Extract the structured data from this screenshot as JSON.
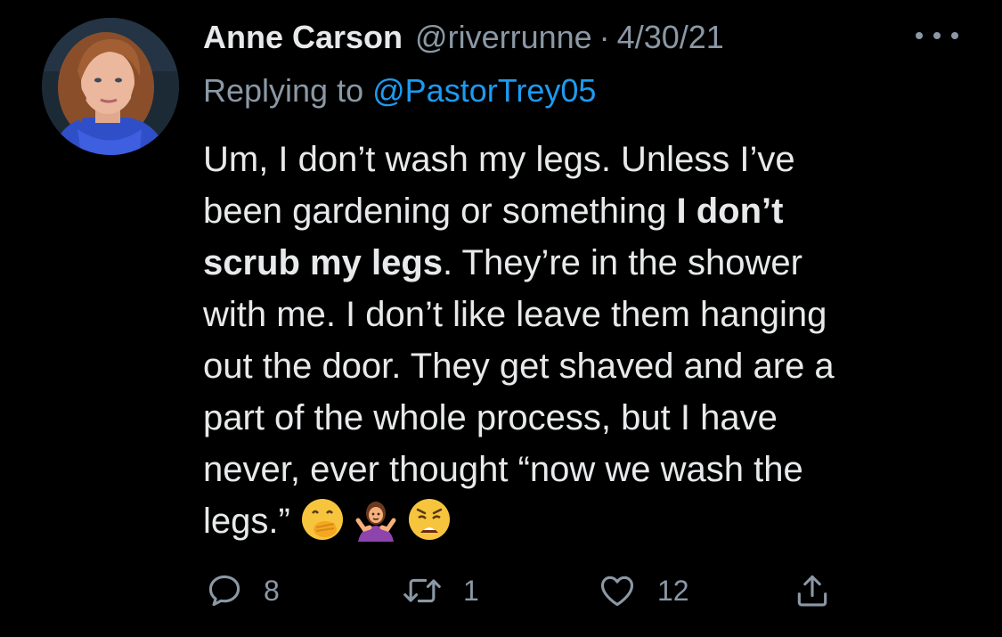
{
  "tweet": {
    "author_name": "Anne Carson",
    "handle": "@riverrunne",
    "separator": "·",
    "date": "4/30/21",
    "replying_prefix": "Replying to ",
    "replying_to": "@PastorTrey05",
    "body": {
      "l1": "Um, I don’t wash my legs. Unless I’ve",
      "l2_a": "been gardening or something ",
      "l2_bold": "I don’t",
      "l3_bold": "scrub my legs",
      "l3_b": ". They’re in the shower",
      "l4": "with me. I don’t like leave them hanging",
      "l5": "out the door. They get shaved and are a",
      "l6": "part of the whole process, but I have",
      "l7": "never, ever thought “now we wash the",
      "l8": "legs.” "
    },
    "emojis": [
      "face-with-hand-over-mouth",
      "person-shrugging",
      "weary-face"
    ],
    "counts": {
      "replies": "8",
      "retweets": "1",
      "likes": "12"
    }
  },
  "colors": {
    "background": "#000000",
    "text": "#e7e9ea",
    "muted": "#8b98a5",
    "link": "#1d9bf0"
  },
  "icons": {
    "reply": "speech-bubble-icon",
    "retweet": "retweet-arrows-icon",
    "like": "heart-icon",
    "share": "share-upload-icon",
    "more": "three-dots-icon"
  }
}
